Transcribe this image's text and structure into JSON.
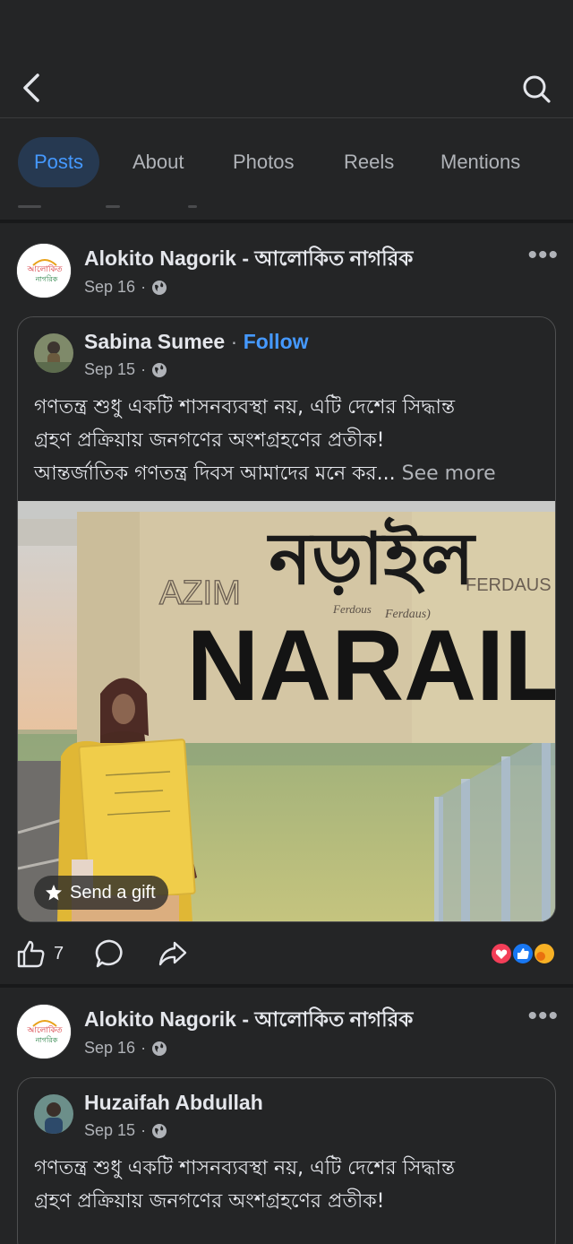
{
  "nav": {
    "back_icon": "chevron-left-icon",
    "search_icon": "search-icon"
  },
  "tabs": [
    {
      "label": "Posts",
      "active": true
    },
    {
      "label": "About",
      "active": false
    },
    {
      "label": "Photos",
      "active": false
    },
    {
      "label": "Reels",
      "active": false
    },
    {
      "label": "Mentions",
      "active": false
    }
  ],
  "posts": [
    {
      "page_name": "Alokito Nagorik - আলোকিত নাগরিক",
      "date": "Sep 16",
      "logo_text_line1": "আলোকিত",
      "logo_text_line2": "নাগরিক",
      "shared": {
        "author": "Sabina Sumee",
        "follow_label": "Follow",
        "date": "Sep 15",
        "text_line1": "গণতন্ত্র শুধু একটি শাসনব্যবস্থা নয়, এটি দেশের সিদ্ধান্ত",
        "text_line2": "গ্রহণ প্রক্রিয়ায় জনগণের অংশগ্রহণের প্রতীক!",
        "text_line3": "আন্তর্জাতিক গণতন্ত্র দিবস আমাদের মনে কর...",
        "see_more": "See more",
        "photo": {
          "sign_bangla": "নড়াইল",
          "sign_english": "NARAIL",
          "graffiti_1": "AZIM",
          "graffiti_2": "FERDAUS",
          "graffiti_3": "Ferdous",
          "graffiti_4": "Ferdaus)"
        },
        "send_gift_label": "Send a gift"
      },
      "like_count": "7"
    },
    {
      "page_name": "Alokito Nagorik - আলোকিত নাগরিক",
      "date": "Sep 16",
      "logo_text_line1": "আলোকিত",
      "logo_text_line2": "নাগরিক",
      "shared": {
        "author": "Huzaifah Abdullah",
        "date": "Sep 15",
        "text_line1": "গণতন্ত্র শুধু একটি শাসনব্যবস্থা নয়, এটি দেশের সিদ্ধান্ত",
        "text_line2": "গ্রহণ প্রক্রিয়ায় জনগণের অংশগ্রহণের প্রতীক!"
      }
    }
  ],
  "colors": {
    "background": "#242526",
    "accent": "#4599ff",
    "active_tab_bg": "#263951",
    "secondary_text": "#b0b3b8"
  }
}
